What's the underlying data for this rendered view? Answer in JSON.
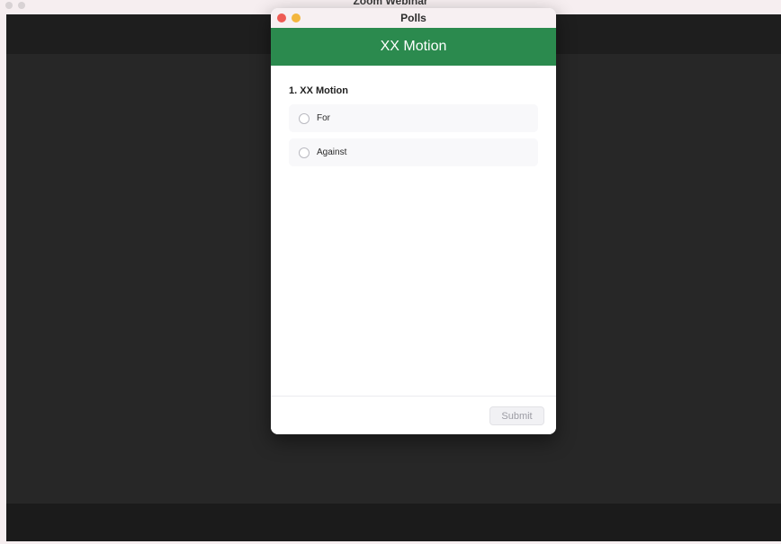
{
  "background_app": {
    "window_title": "Zoom Webinar"
  },
  "polls_dialog": {
    "window_title": "Polls",
    "poll_title": "XX Motion",
    "question": "1. XX Motion",
    "options": [
      {
        "label": "For",
        "selected": false
      },
      {
        "label": "Against",
        "selected": false
      }
    ],
    "submit_label": "Submit",
    "submit_enabled": false
  },
  "colors": {
    "poll_header": "#2b8a4e",
    "close_light": "#ee5b54",
    "minimize_light": "#f3b63e",
    "stage_background": "#272727"
  }
}
